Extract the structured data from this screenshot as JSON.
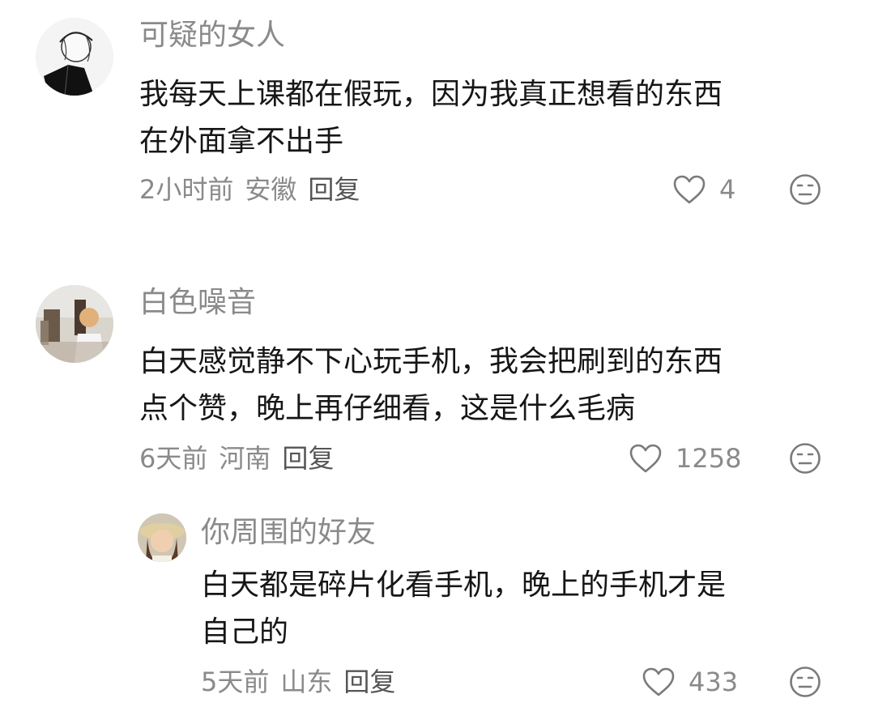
{
  "comments": [
    {
      "username": "可疑的女人",
      "text_line1": "我每天上课都在假玩，因为我真正想看的东西",
      "text_line2": "在外面拿不出手",
      "time": "2小时前",
      "location": "安徽",
      "reply": "回复",
      "likes": "4"
    },
    {
      "username": "白色噪音",
      "text_line1": "白天感觉静不下心玩手机，我会把刷到的东西",
      "text_line2": "点个赞，晚上再仔细看，这是什么毛病",
      "time": "6天前",
      "location": "河南",
      "reply": "回复",
      "likes": "1258"
    },
    {
      "username": "你周围的好友",
      "text_line1": "白天都是碎片化看手机，晚上的手机才是",
      "text_line2": "自己的",
      "time": "5天前",
      "location": "山东",
      "reply": "回复",
      "likes": "433"
    }
  ],
  "icons": {
    "like": "heart-outline-icon",
    "dislike": "meh-face-icon"
  },
  "colors": {
    "meta_gray": "#8a8a8a",
    "text_dark": "#161616"
  }
}
